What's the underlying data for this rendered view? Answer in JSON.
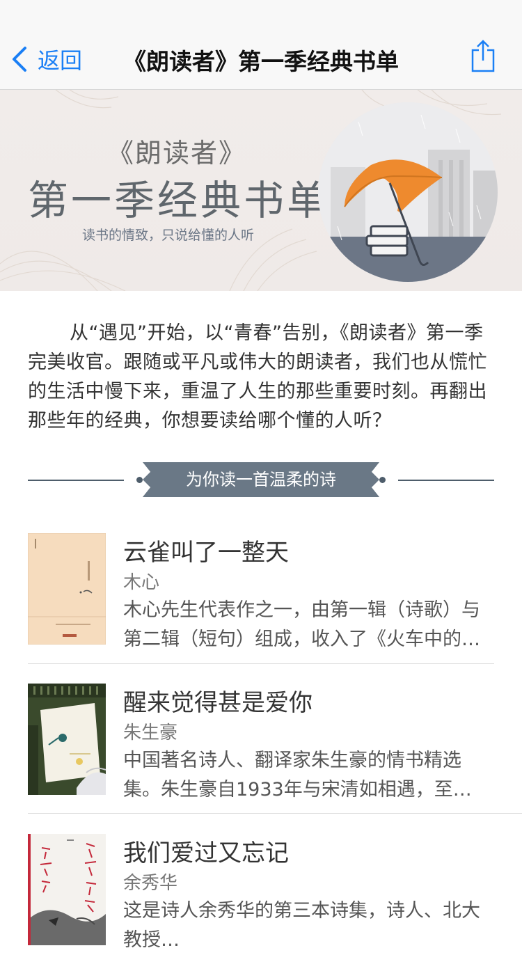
{
  "nav": {
    "back_label": "返回",
    "title": "《朗读者》第一季经典书单"
  },
  "banner": {
    "sub_title": "《朗读者》",
    "main_title": "第一季经典书单",
    "slogan": "读书的情致，只说给懂的人听"
  },
  "intro": {
    "lines": [
      "从“遇见”开始，以“青春”告别，《朗读者》第一",
      "季完美收官。跟随或平凡或伟大的朗读者，我们也从",
      "慌忙的生活中慢下来，重温了人生的那些重要时刻。",
      "再翻出那些年的经典，你想要读给哪个懂的人听？"
    ]
  },
  "section": {
    "heading": "为你读一首温柔的诗"
  },
  "books": [
    {
      "title": "云雀叫了一整天",
      "author": "木心",
      "desc_line1": "木心先生代表作之一，由第一辑（诗歌）与",
      "desc_line2": "第二辑（短句）组成，收入了《火车中的…"
    },
    {
      "title": "醒来觉得甚是爱你",
      "author": "朱生豪",
      "desc_line1": "中国著名诗人、翻译家朱生豪的情书精选",
      "desc_line2": "集。朱生豪自1933年与宋清如相遇，至…"
    },
    {
      "title": "我们爱过又忘记",
      "author": "余秀华",
      "desc_line1": "这是诗人余秀华的第三本诗集，诗人、北大",
      "desc_line2": "教授…"
    }
  ],
  "colors": {
    "accent": "#1a7ff5",
    "ribbon": "#6a7886",
    "umbrella": "#ee8a2e"
  }
}
